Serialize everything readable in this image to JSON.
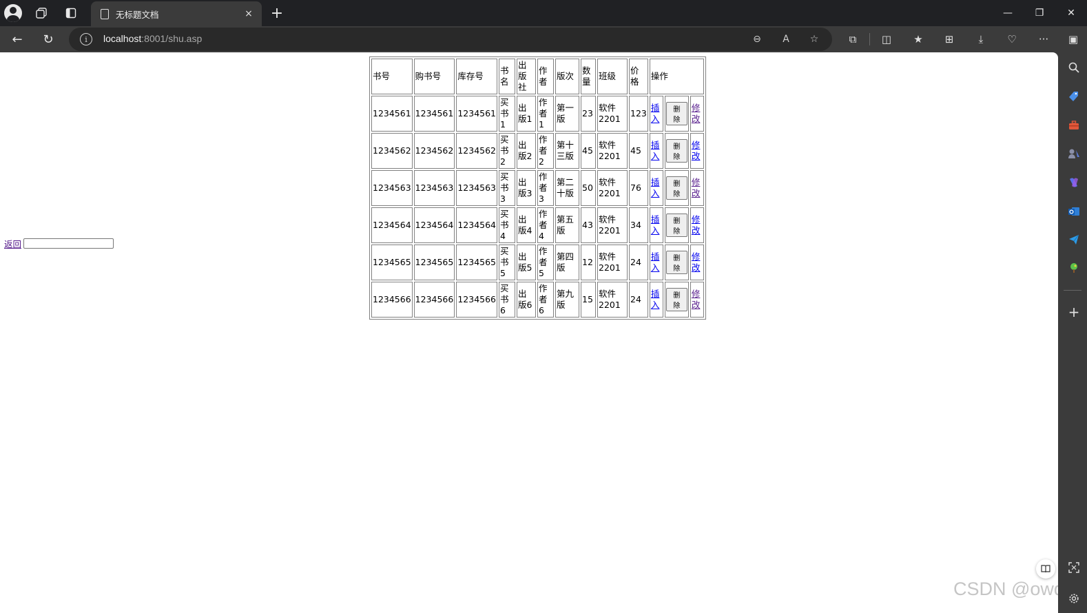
{
  "browser": {
    "tab_title": "无标题文档",
    "url_host": "localhost",
    "url_rest": ":8001/shu.asp",
    "icons": {
      "profile": "profile-icon",
      "workspaces": "workspaces-icon",
      "vertical_tabs": "vertical-tabs-icon",
      "tab_close": "×",
      "new_tab": "+",
      "minimize": "—",
      "restore": "❐",
      "close": "✕",
      "back": "←",
      "refresh": "↻",
      "info": "i",
      "zoom_out": "⊖",
      "read_aloud": "A",
      "favorite": "☆",
      "extensions": "⧉",
      "split_screen": "◫",
      "favorites": "★",
      "collections": "⊞",
      "downloads": "⤓",
      "performance": "♡",
      "more": "···",
      "sidebar_toggle": "▣"
    }
  },
  "table": {
    "headers": [
      "书号",
      "购书号",
      "库存号",
      "书名",
      "出版社",
      "作者",
      "版次",
      "数量",
      "班级",
      "价格",
      "操作"
    ],
    "rows": [
      {
        "book_no": "1234561",
        "purchase_no": "1234561",
        "stock_no": "1234561",
        "title": "买书1",
        "publisher": "出版1",
        "author": "作者1",
        "edition": "第一版",
        "qty": "23",
        "cls": "软件2201",
        "price": "123"
      },
      {
        "book_no": "1234562",
        "purchase_no": "1234562",
        "stock_no": "1234562",
        "title": "买书2",
        "publisher": "出版2",
        "author": "作者2",
        "edition": "第十三版",
        "qty": "45",
        "cls": "软件2201",
        "price": "45"
      },
      {
        "book_no": "1234563",
        "purchase_no": "1234563",
        "stock_no": "1234563",
        "title": "买书3",
        "publisher": "出版3",
        "author": "作者3",
        "edition": "第二十版",
        "qty": "50",
        "cls": "软件2201",
        "price": "76"
      },
      {
        "book_no": "1234564",
        "purchase_no": "1234564",
        "stock_no": "1234564",
        "title": "买书4",
        "publisher": "出版4",
        "author": "作者4",
        "edition": "第五版",
        "qty": "43",
        "cls": "软件2201",
        "price": "34"
      },
      {
        "book_no": "1234565",
        "purchase_no": "1234565",
        "stock_no": "1234565",
        "title": "买书5",
        "publisher": "出版5",
        "author": "作者5",
        "edition": "第四版",
        "qty": "12",
        "cls": "软件2201",
        "price": "24"
      },
      {
        "book_no": "1234566",
        "purchase_no": "1234566",
        "stock_no": "1234566",
        "title": "买书6",
        "publisher": "出版6",
        "author": "作者6",
        "edition": "第九版",
        "qty": "15",
        "cls": "软件2201",
        "price": "24"
      }
    ],
    "insert_label": "插入",
    "delete_label": "删除",
    "modify_label": "修改"
  },
  "footer": {
    "back_label": "返回",
    "input_value": ""
  },
  "watermark": "CSDN @owde",
  "colors": {
    "link": "#0000ee",
    "visited_link": "#551a8b",
    "chrome_dark": "#202124",
    "chrome": "#3b3b3b"
  }
}
